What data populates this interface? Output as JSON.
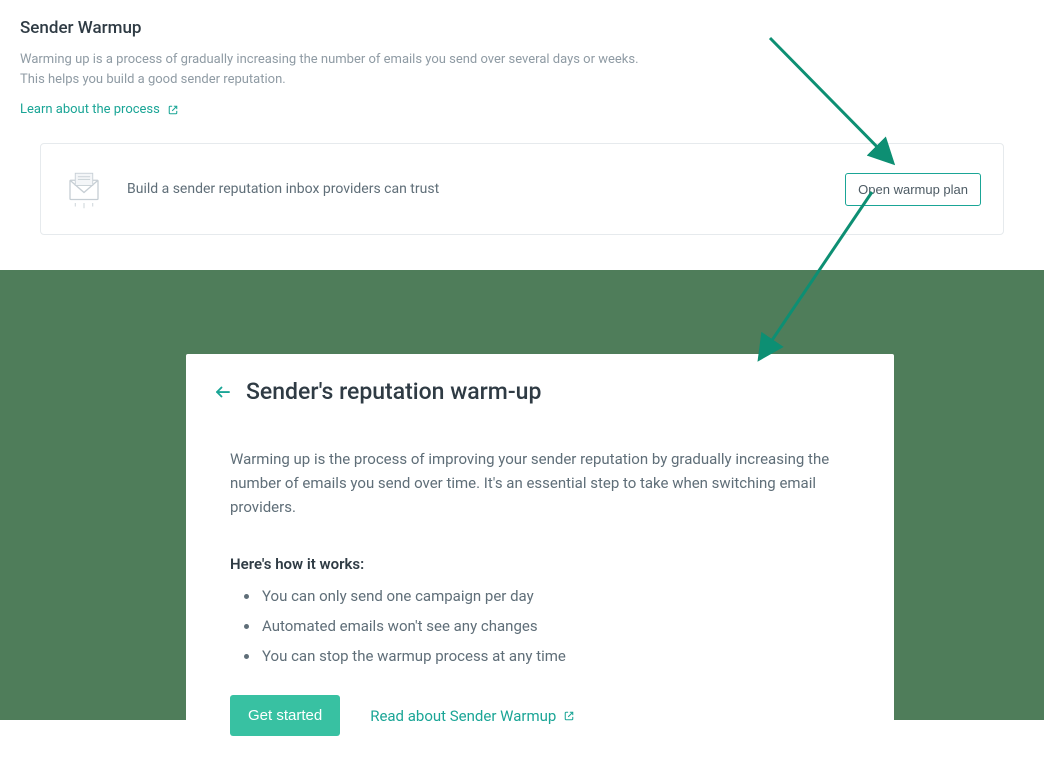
{
  "top": {
    "title": "Sender Warmup",
    "description": "Warming up is a process of gradually increasing the number of emails you send over several days or weeks. This helps you build a good sender reputation.",
    "learn_link": "Learn about the process"
  },
  "card": {
    "message": "Build a sender reputation inbox providers can trust",
    "button": "Open warmup plan"
  },
  "panel": {
    "title": "Sender's reputation warm-up",
    "description": "Warming up is the process of improving your sender reputation by gradually increasing the number of emails you send over time. It's an essential step to take when switching email providers.",
    "how_title": "Here's how it works:",
    "bullets": [
      "You can only send one campaign per day",
      "Automated emails won't see any changes",
      "You can stop the warmup process at any time"
    ],
    "get_started": "Get started",
    "read_link": "Read about Sender Warmup"
  },
  "colors": {
    "accent": "#1aa596",
    "primary_btn": "#38c1a2",
    "band": "#4f7d5a"
  }
}
